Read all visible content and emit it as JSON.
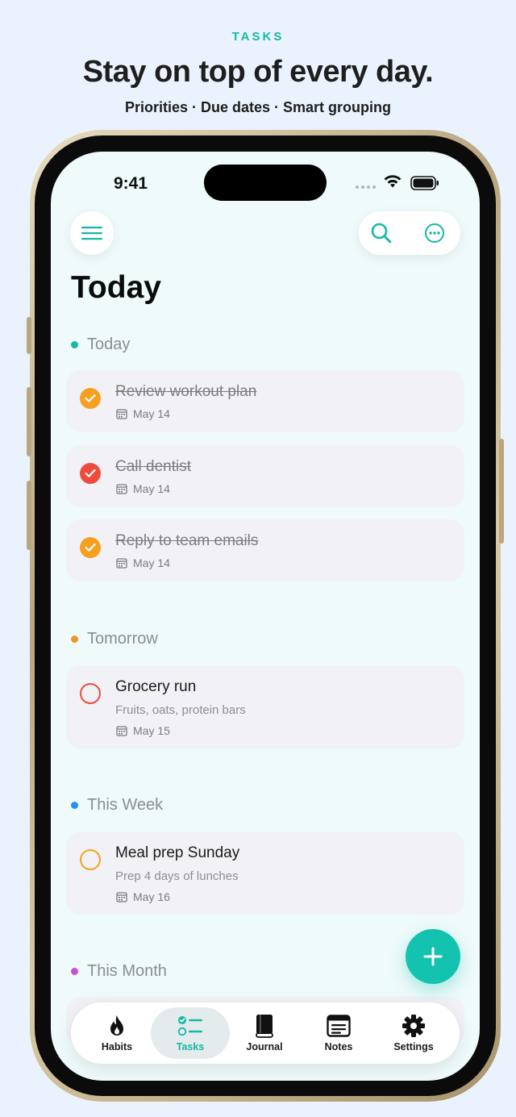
{
  "promo": {
    "tag": "TASKS",
    "headline": "Stay on top of every day.",
    "subline": "Priorities · Due dates · Smart grouping"
  },
  "status_bar": {
    "time": "9:41"
  },
  "header": {
    "title": "Today"
  },
  "colors": {
    "accent": "#14c2b0",
    "today_dot": "#17b8a4",
    "tomorrow_dot": "#f0962a",
    "this_week_dot": "#2a90f0",
    "this_month_dot": "#c94fd8"
  },
  "sections": [
    {
      "label": "Today",
      "tasks": [
        {
          "title": "Review workout plan",
          "date": "May 14",
          "done": true,
          "check_color": "#f7a020"
        },
        {
          "title": "Call dentist",
          "date": "May 14",
          "done": true,
          "check_color": "#ef4b3c"
        },
        {
          "title": "Reply to team emails",
          "date": "May 14",
          "done": true,
          "check_color": "#f7a020"
        }
      ]
    },
    {
      "label": "Tomorrow",
      "tasks": [
        {
          "title": "Grocery run",
          "note": "Fruits, oats, protein bars",
          "date": "May 15",
          "done": false,
          "check_color": "#ef4b3c"
        }
      ]
    },
    {
      "label": "This Week",
      "tasks": [
        {
          "title": "Meal prep Sunday",
          "note": "Prep 4 days of lunches",
          "date": "May 16",
          "done": false,
          "check_color": "#f7a020"
        }
      ]
    },
    {
      "label": "This Month",
      "tasks": []
    }
  ],
  "tabbar": {
    "tabs": [
      {
        "label": "Habits",
        "icon": "flame-icon",
        "active": false
      },
      {
        "label": "Tasks",
        "icon": "checklist-icon",
        "active": true
      },
      {
        "label": "Journal",
        "icon": "book-icon",
        "active": false
      },
      {
        "label": "Notes",
        "icon": "notes-icon",
        "active": false
      },
      {
        "label": "Settings",
        "icon": "gear-icon",
        "active": false
      }
    ]
  }
}
